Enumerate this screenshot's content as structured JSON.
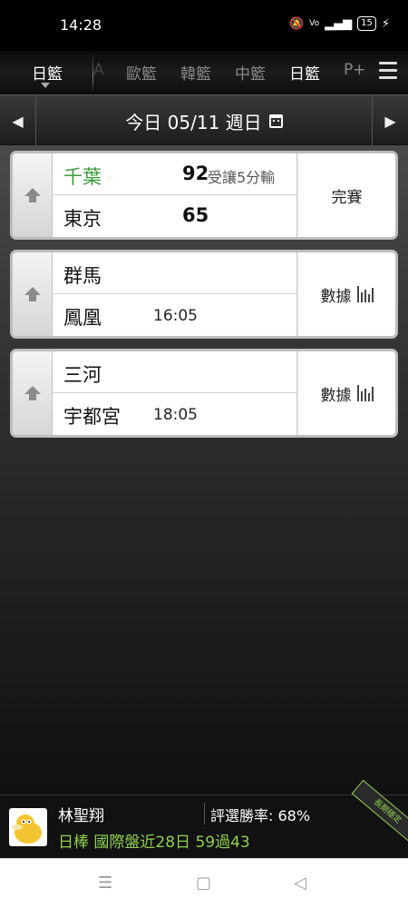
{
  "status_bar": {
    "time": "14:28",
    "icons": [
      "mute-icon",
      "vo-lte-icon",
      "signal-icon"
    ],
    "battery": "15"
  },
  "tabs": [
    {
      "label": "日籃",
      "active": true
    },
    {
      "label": "A",
      "active": false
    },
    {
      "label": "歐籃",
      "active": false
    },
    {
      "label": "韓籃",
      "active": false
    },
    {
      "label": "中籃",
      "active": false
    },
    {
      "label": "日籃",
      "active": true
    },
    {
      "label": "P+",
      "active": false
    }
  ],
  "date_bar": {
    "label": "今日 05/11 週日"
  },
  "games": [
    {
      "home": "千葉",
      "home_score": "92",
      "note": "受讓5分輸",
      "away": "東京",
      "away_score": "65",
      "status": "完賽"
    },
    {
      "home": "群馬",
      "away": "鳳凰",
      "time": "16:05",
      "status": "數據"
    },
    {
      "home": "三河",
      "away": "宇都宮",
      "time": "18:05",
      "status": "數據"
    }
  ],
  "banner": {
    "name": "林聖翔",
    "rate": "評選勝率: 68%",
    "record": "日棒 國際盤近28日 59過43",
    "ribbon": "長期穩定",
    "accent": "#8fd14f"
  },
  "colors": {
    "winner_text": "#3c9a3c",
    "card_bg": "#ffffff",
    "background": "#2e2e2e"
  }
}
